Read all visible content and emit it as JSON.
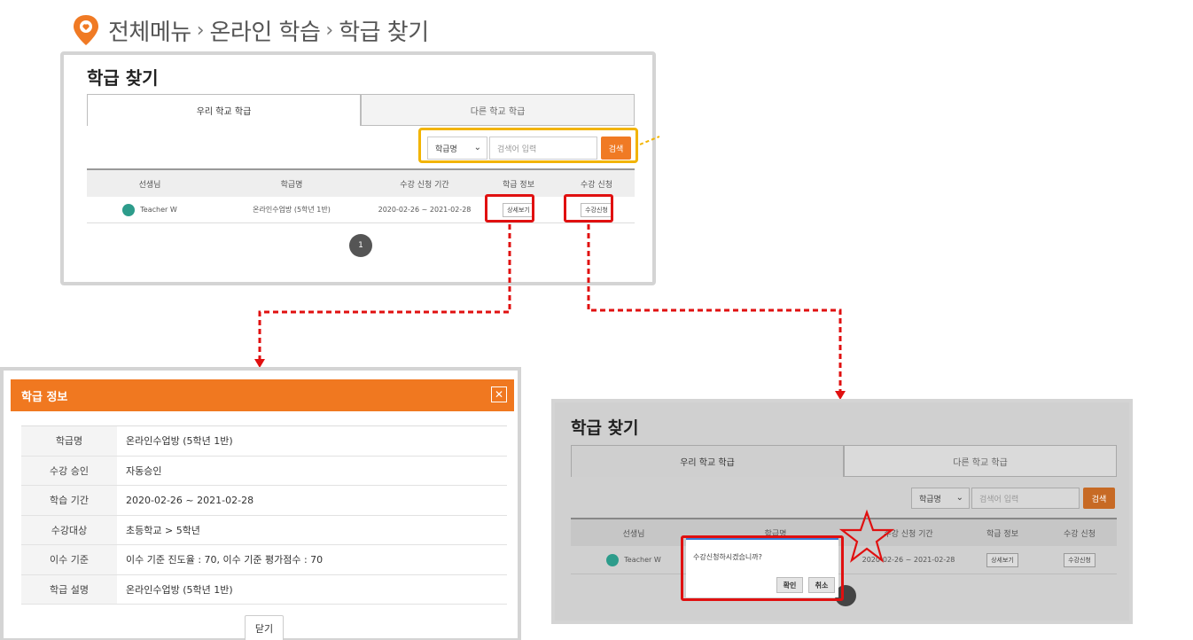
{
  "breadcrumb": {
    "items": [
      "전체메뉴",
      "온라인 학습",
      "학급 찾기"
    ],
    "separator": "›",
    "pin_color": "#f07a24"
  },
  "search_panel": {
    "title": "학급 찾기",
    "tabs": [
      "우리 학교 학급",
      "다른 학교 학급"
    ],
    "select_value": "학급명",
    "input_placeholder": "검색어 입력",
    "search_button": "검색",
    "columns": [
      "선생님",
      "학급명",
      "수강 신청 기간",
      "학급 정보",
      "수강 신청"
    ],
    "row": {
      "teacher": "Teacher W",
      "class_name": "온라인수업방 (5학년 1반)",
      "period": "2020-02-26 ~ 2021-02-28",
      "detail_button": "상세보기",
      "apply_button": "수강신청"
    },
    "page": "1"
  },
  "modal": {
    "title": "학급 정보",
    "close_icon": "close-icon",
    "rows": [
      {
        "label": "학급명",
        "value": "온라인수업방 (5학년 1반)"
      },
      {
        "label": "수강 승인",
        "value": "자동승인"
      },
      {
        "label": "학습 기간",
        "value": "2020-02-26 ~ 2021-02-28"
      },
      {
        "label": "수강대상",
        "value": "초등학교 > 5학년"
      },
      {
        "label": "이수 기준",
        "value": "이수 기준 진도율 : 70, 이수 기준 평가점수 : 70"
      },
      {
        "label": "학급 설명",
        "value": "온라인수업방 (5학년 1반)"
      }
    ],
    "close_button": "닫기",
    "header_color": "#f07820"
  },
  "grey_panel": {
    "title": "학급 찾기",
    "tabs": [
      "우리 학교 학급",
      "다른 학교 학급"
    ],
    "select_value": "학급명",
    "input_placeholder": "검색어 입력",
    "search_button": "검색",
    "columns": [
      "선생님",
      "학급명",
      "수강 신청 기간",
      "학급 정보",
      "수강 신청"
    ],
    "row": {
      "teacher": "Teacher W",
      "period": "2020-02-26 ~ 2021-02-28",
      "detail_button": "상세보기",
      "apply_button": "수강신청"
    },
    "confirm": {
      "message": "수강신청하시겠습니까?",
      "ok": "확인",
      "cancel": "취소"
    }
  },
  "colors": {
    "accent": "#f07a24",
    "highlight_red": "#e01010",
    "highlight_yellow": "#f2b400"
  }
}
